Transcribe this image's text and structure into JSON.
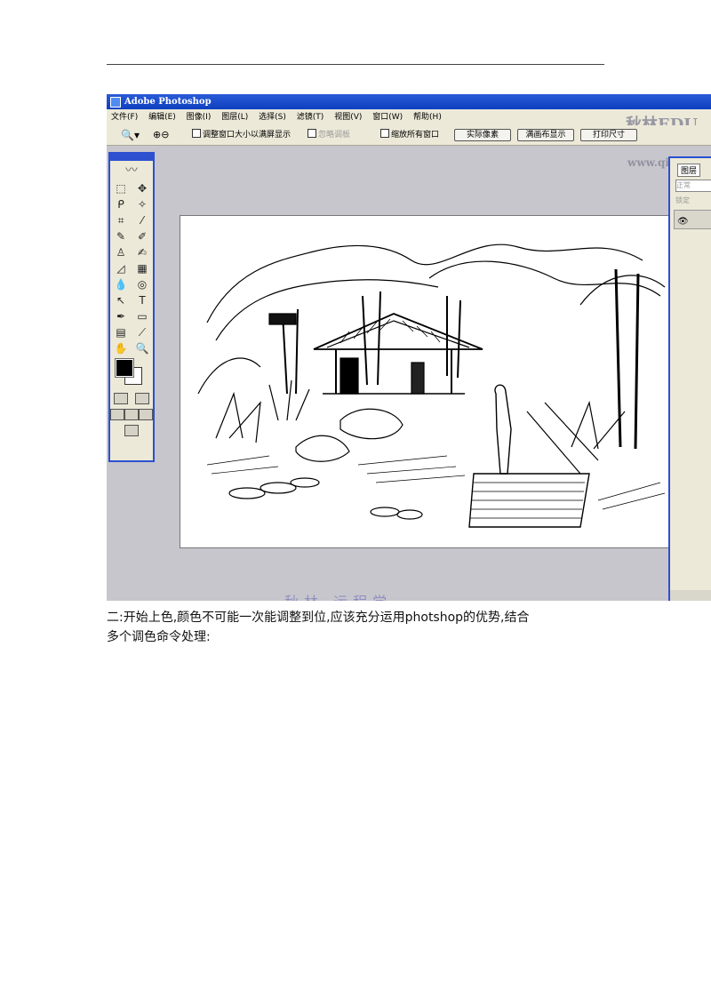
{
  "app": {
    "title": "Adobe Photoshop",
    "menu": [
      "文件(F)",
      "编辑(E)",
      "图像(I)",
      "图层(L)",
      "选择(S)",
      "滤镜(T)",
      "视图(V)",
      "窗口(W)",
      "帮助(H)"
    ],
    "options": {
      "resize_window": "调整窗口大小以满屏显示",
      "ignore_palettes": "忽略调板",
      "zoom_all": "缩放所有窗口",
      "actual_pixels": "实际像素",
      "fit_screen": "满画布显示",
      "print_size": "打印尺寸"
    },
    "watermark_top": "秋林EDU",
    "watermark_url": "www.qiul",
    "layers_panel": {
      "tab": "图层",
      "mode": "正常",
      "lock": "锁定"
    }
  },
  "paragraph": {
    "line1": "二:开始上色,颜色不可能一次能调整到位,应该充分运用photshop的优势,结合",
    "line2": "多个调色命令处理:"
  }
}
